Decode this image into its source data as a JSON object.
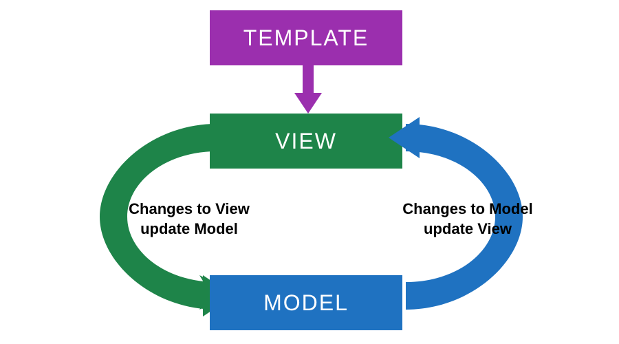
{
  "boxes": {
    "template": {
      "label": "TEMPLATE",
      "color": "#9b2fae"
    },
    "view": {
      "label": "VIEW",
      "color": "#1e8449"
    },
    "model": {
      "label": "MODEL",
      "color": "#1f72c1"
    }
  },
  "arrows": {
    "template_to_view": {
      "color": "#9b2fae"
    },
    "view_to_model": {
      "color": "#1e8449",
      "label": "Changes to View update Model"
    },
    "model_to_view": {
      "color": "#1f72c1",
      "label": "Changes to Model update View"
    }
  }
}
